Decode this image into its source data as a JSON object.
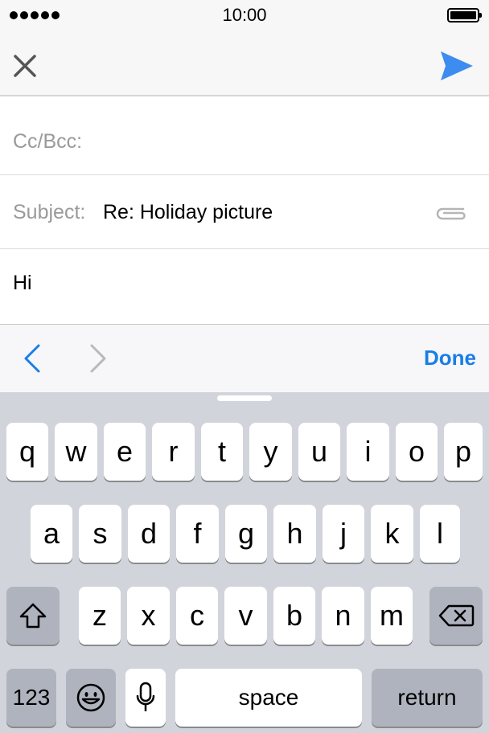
{
  "status_bar": {
    "time": "10:00"
  },
  "compose": {
    "cc_bcc_label": "Cc/Bcc:",
    "subject_label": "Subject:",
    "subject_value": "Re: Holiday picture",
    "body_text": "Hi"
  },
  "accessory": {
    "done_label": "Done"
  },
  "keyboard": {
    "row1": [
      "q",
      "w",
      "e",
      "r",
      "t",
      "y",
      "u",
      "i",
      "o",
      "p"
    ],
    "row2": [
      "a",
      "s",
      "d",
      "f",
      "g",
      "h",
      "j",
      "k",
      "l"
    ],
    "row3": [
      "z",
      "x",
      "c",
      "v",
      "b",
      "n",
      "m"
    ],
    "numbers_label": "123",
    "space_label": "space",
    "return_label": "return"
  },
  "icons": {
    "close": "close-icon",
    "send": "send-icon",
    "attachment": "paperclip-icon",
    "prev": "chevron-left-icon",
    "next": "chevron-right-icon",
    "shift": "shift-icon",
    "delete": "delete-icon",
    "emoji": "emoji-icon",
    "mic": "microphone-icon"
  },
  "colors": {
    "accent": "#1a7ee6",
    "send": "#3d8cf0",
    "keyboard_bg": "#d1d5db"
  }
}
